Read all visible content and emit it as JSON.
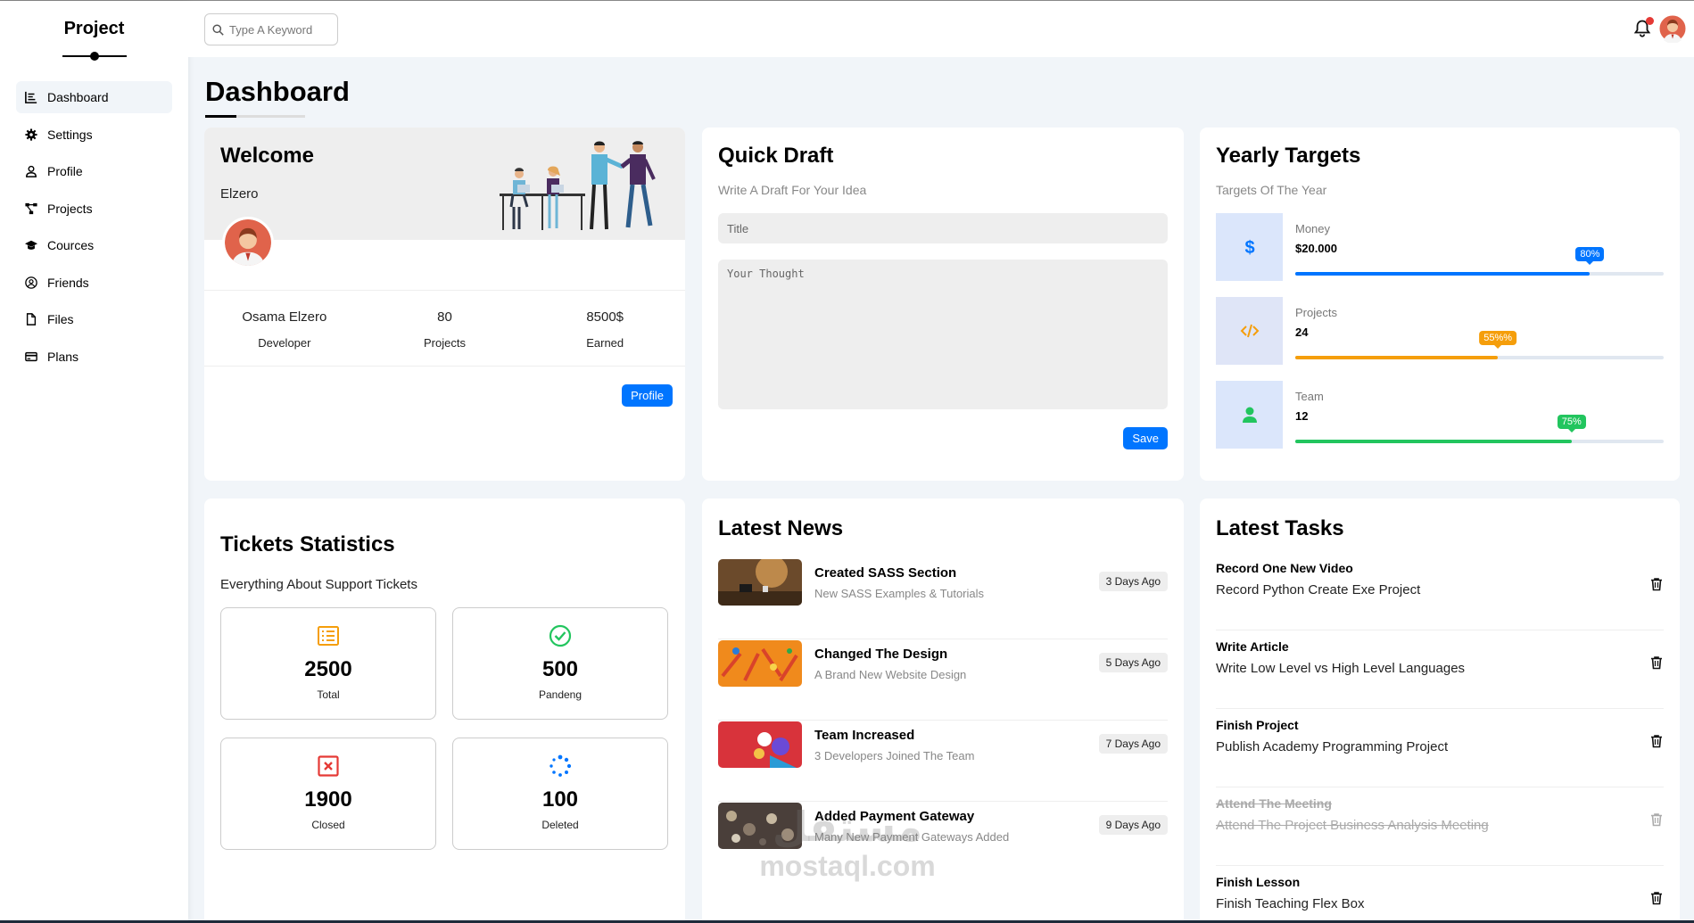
{
  "sidebar": {
    "brand": "Project",
    "items": [
      {
        "label": "Dashboard",
        "icon": "chart-icon"
      },
      {
        "label": "Settings",
        "icon": "gear-icon"
      },
      {
        "label": "Profile",
        "icon": "user-icon"
      },
      {
        "label": "Projects",
        "icon": "diagram-icon"
      },
      {
        "label": "Cources",
        "icon": "graduation-cap-icon"
      },
      {
        "label": "Friends",
        "icon": "user-circle-icon"
      },
      {
        "label": "Files",
        "icon": "file-icon"
      },
      {
        "label": "Plans",
        "icon": "credit-card-icon"
      }
    ],
    "active_index": 0
  },
  "topbar": {
    "search_placeholder": "Type A Keyword",
    "notification_badge_color": "#e53935"
  },
  "page": {
    "title": "Dashboard"
  },
  "welcome": {
    "title": "Welcome",
    "subtitle": "Elzero",
    "stats": [
      {
        "value": "Osama Elzero",
        "label": "Developer"
      },
      {
        "value": "80",
        "label": "Projects"
      },
      {
        "value": "8500$",
        "label": "Earned"
      }
    ],
    "button": "Profile"
  },
  "quick_draft": {
    "title": "Quick Draft",
    "subtitle": "Write A Draft For Your Idea",
    "title_placeholder": "Title",
    "thought_placeholder": "Your Thought",
    "button": "Save"
  },
  "targets": {
    "title": "Yearly Targets",
    "subtitle": "Targets Of The Year",
    "items": [
      {
        "label": "Money",
        "value": "$20.000",
        "percent": 80,
        "badge": "80%",
        "color": "#0075ff",
        "bg": "#dbe6fb",
        "icon": "dollar-icon"
      },
      {
        "label": "Projects",
        "value": "24",
        "percent": 55,
        "badge": "55%%",
        "color": "#f59e0b",
        "bg": "#dfe5f7",
        "icon": "code-icon"
      },
      {
        "label": "Team",
        "value": "12",
        "percent": 75,
        "badge": "75%",
        "color": "#22c55e",
        "bg": "#dbe6fb",
        "icon": "user-icon"
      }
    ]
  },
  "tickets": {
    "title": "Tickets Statistics",
    "subtitle": "Everything About Support Tickets",
    "items": [
      {
        "value": "2500",
        "label": "Total",
        "icon": "list-icon",
        "color": "#f59e0b"
      },
      {
        "value": "500",
        "label": "Pandeng",
        "icon": "check-circle-icon",
        "color": "#22c55e"
      },
      {
        "value": "1900",
        "label": "Closed",
        "icon": "close-box-icon",
        "color": "#e53935"
      },
      {
        "value": "100",
        "label": "Deleted",
        "icon": "spinner-icon",
        "color": "#0075ff"
      }
    ]
  },
  "news": {
    "title": "Latest News",
    "items": [
      {
        "title": "Created SASS Section",
        "desc": "New SASS Examples & Tutorials",
        "date": "3 Days Ago"
      },
      {
        "title": "Changed The Design",
        "desc": "A Brand New Website Design",
        "date": "5 Days Ago"
      },
      {
        "title": "Team Increased",
        "desc": "3 Developers Joined The Team",
        "date": "7 Days Ago"
      },
      {
        "title": "Added Payment Gateway",
        "desc": "Many New Payment Gateways Added",
        "date": "9 Days Ago"
      }
    ]
  },
  "tasks": {
    "title": "Latest Tasks",
    "items": [
      {
        "title": "Record One New Video",
        "desc": "Record Python Create Exe Project",
        "done": false
      },
      {
        "title": "Write Article",
        "desc": "Write Low Level vs High Level Languages",
        "done": false
      },
      {
        "title": "Finish Project",
        "desc": "Publish Academy Programming Project",
        "done": false
      },
      {
        "title": "Attend The Meeting",
        "desc": "Attend The Project Business Analysis Meeting",
        "done": true
      },
      {
        "title": "Finish Lesson",
        "desc": "Finish Teaching Flex Box",
        "done": false
      }
    ]
  },
  "watermark": {
    "arabic": "مستقل",
    "latin": "mostaql.com"
  }
}
